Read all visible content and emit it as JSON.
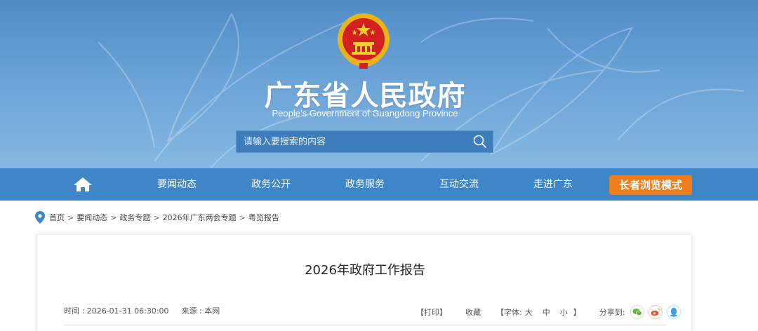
{
  "header": {
    "site_title": "广东省人民政府",
    "site_subtitle": "People’s Government of Guangdong Province",
    "search_placeholder": "请输入要搜索的内容"
  },
  "nav": {
    "items": [
      "要闻动态",
      "政务公开",
      "政务服务",
      "互动交流",
      "走进广东"
    ],
    "elder_mode": "长者浏览模式"
  },
  "breadcrumb": [
    "首页",
    "要闻动态",
    "政务专题",
    "2026年广东两会专题",
    "粤览报告"
  ],
  "article": {
    "title": "2026年政府工作报告",
    "time": "时间 : 2026-01-31 06:30:00",
    "source": "来源 : 本网",
    "print": "【打印】",
    "favorite": "收藏",
    "font_label": "【字体:",
    "font_large": "大",
    "font_medium": "中",
    "font_small": "小",
    "font_close": "】",
    "share_label": "分享到:"
  },
  "colors": {
    "banner": "#5b96cf",
    "nav": "#3e86c8",
    "elder_button": "#ef7d1a",
    "wechat": "#5fb936",
    "weibo": "#e6553a",
    "qq": "#3aa3e3"
  }
}
